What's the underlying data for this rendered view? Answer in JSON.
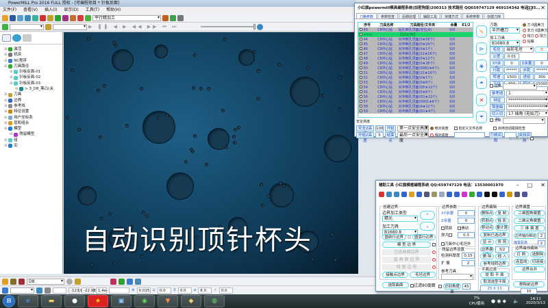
{
  "app": {
    "title": "PowerMILL Pro 2016 FULL 授权 - [可编程项目 * 针板反面]"
  },
  "menu": [
    "文件(F)",
    "查看(V)",
    "插入(I)",
    "显示(D)",
    "工具(T)",
    "帮助(H)"
  ],
  "toolbar": {
    "strategy_combo": "平行精加工"
  },
  "tree": [
    {
      "label": "激活",
      "indent": 0
    },
    {
      "label": "机床",
      "indent": 0
    },
    {
      "label": "NC程序",
      "indent": 0
    },
    {
      "label": "刀具路径",
      "indent": 0
    },
    {
      "label": "针板反面-01",
      "indent": 1
    },
    {
      "label": "针板反面-02",
      "indent": 1
    },
    {
      "label": "针板反面-03",
      "indent": 1
    },
    {
      "label": "> 3_D8_筹凸(关",
      "indent": 2
    },
    {
      "label": "刀具",
      "indent": 0
    },
    {
      "label": "边界",
      "indent": 0
    },
    {
      "label": "参考线",
      "indent": 0
    },
    {
      "label": "特征设置",
      "indent": 0
    },
    {
      "label": "用户坐标系",
      "indent": 0
    },
    {
      "label": "层和组合",
      "indent": 0
    },
    {
      "label": "模型",
      "indent": 0
    },
    {
      "label": "残留模型",
      "indent": 1
    },
    {
      "label": "组",
      "indent": 0
    },
    {
      "label": "宏",
      "indent": 0
    }
  ],
  "overlay_caption": "自动识别顶针杯头",
  "bottom": {
    "tool_combo": "D8",
    "coords": [
      "-123.6",
      "-22.988",
      "1.4e-5"
    ],
    "tolerance": "0.015",
    "thickness": "0.0",
    "axial": "0.0",
    "diameter": "8.0",
    "angle": "0.0"
  },
  "taskbar": {
    "cpu": "7%",
    "cpu_label": "CPU使用",
    "time": "14:11",
    "date": "2020/3/13"
  },
  "dlg1": {
    "title": "小红旗powermill模具编程系统(加密狗版)200313  技术路径 QQ659747129 469154342  电话135...",
    "tabs": [
      "刀路参数",
      "参数检查",
      "后期处理",
      "辅助工具",
      "快捷方式",
      "系统参数",
      "创建刀库"
    ],
    "columns": [
      "序号",
      "刀具名称",
      "刀具路径/文件夹",
      "余量",
      "E1/2"
    ],
    "rows": [
      {
        "no": "43",
        "tool": "C8中心钻",
        "path": "钻孔倒孔顶面(定位点)",
        "allow": "0/0"
      },
      {
        "no": "+++",
        "tool": "",
        "path": "【121/35】",
        "allow": "",
        "hl": true
      },
      {
        "no": "44",
        "tool": "C8中心钻",
        "path": "对冲倒孔顶面(0★56个)",
        "allow": "0/0"
      },
      {
        "no": "45",
        "tool": "C8中心钻",
        "path": "对冲倒孔顶面(0★24个)",
        "allow": "0/0"
      },
      {
        "no": "46",
        "tool": "C8中心钻",
        "path": "对冲倒孔顶面(0★1个)",
        "allow": "0/0"
      },
      {
        "no": "47",
        "tool": "C8中心钻",
        "path": "对冲倒孔顶面(22★16个)",
        "allow": "0/0"
      },
      {
        "no": "48",
        "tool": "C8中心钻",
        "path": "对冲倒孔顶面(0★12个)",
        "allow": "0/0"
      },
      {
        "no": "49",
        "tool": "C8中心钻",
        "path": "对冲倒孔顶面(0★26个)",
        "allow": "0/0"
      },
      {
        "no": "50",
        "tool": "C8中心钻",
        "path": "对冲倒孔顶面(0082★4个)",
        "allow": "0/0"
      },
      {
        "no": "51",
        "tool": "C8中心钻",
        "path": "对冲倒孔顶面(22★16个)",
        "allow": "0/0"
      },
      {
        "no": "52",
        "tool": "C8中心钻",
        "path": "对冲倒孔顶面(0★1个)",
        "allow": "0/0"
      },
      {
        "no": "53",
        "tool": "C8中心钻",
        "path": "对冲倒孔顶面(0★6个)",
        "allow": "0/0"
      },
      {
        "no": "54",
        "tool": "C8中心钻",
        "path": "对冲倒孔顶面(DP★12个)",
        "allow": "0/0"
      },
      {
        "no": "55",
        "tool": "C8中心钻",
        "path": "对冲倒孔顶面(0★6个)",
        "allow": "0/0"
      },
      {
        "no": "56",
        "tool": "C8中心钻",
        "path": "对冲倒孔顶面(D1★22个)",
        "allow": "0/0"
      },
      {
        "no": "57",
        "tool": "C8中心钻",
        "path": "对冲倒孔顶面(0001★6个)",
        "allow": "0/0"
      },
      {
        "no": "58",
        "tool": "C8中心钻",
        "path": "对冲倒孔顶面(A★11个)",
        "allow": "0/0"
      },
      {
        "no": "59",
        "tool": "C8中心钻",
        "path": "对冲倒孔顶面(D1★4个)",
        "allow": "0/0"
      }
    ],
    "toolpath_label": "刀路",
    "toolpath_value": "半开槽刀",
    "tool_label": "加工刀具",
    "tool_value": "B1680.8",
    "radios": [
      "刀 0圆鼻刀",
      "非刀 0圆鼻刀",
      "铣刀",
      "球刀",
      "钻嘴"
    ],
    "params": [
      [
        "毛坯",
        "当前毛坯"
      ],
      [
        "公差",
        "0.01"
      ],
      [
        "XY余量",
        "0",
        "Z余量",
        "0"
      ],
      [
        "行距",
        "******",
        "步距",
        "******"
      ],
      [
        "转速",
        "1500",
        "进给",
        "300"
      ],
      [
        "下切",
        "300",
        "掠过",
        "15000"
      ]
    ],
    "boundary_label": "边界",
    "ref_label": "参考线",
    "ref_value": "1",
    "feature_label": "特征",
    "feature_value": "**********************",
    "feature2_label": "驾驶曲面",
    "feature2_value": "**********************",
    "lead_label": "切入切出",
    "lead_value": "17 插角 (无抬刀)",
    "global_label": "全体",
    "safe_group": "安全高度",
    "safe_z_label": "安全Z高度",
    "safe_z": "100",
    "start_z_label": "开始Z高度",
    "start_z": "5",
    "start_pt_label": "开始点",
    "start_pt": "第一点安全高度",
    "end_pt_label": "结束点",
    "end_pt": "最后一点安全高度",
    "abs_label": "绝对高度",
    "rel_label": "相对高度",
    "custom_name_label": "自定义文件名称",
    "auto_check_label": "启用自动碰撞检查",
    "holder_clear_label": "刀柄间隙",
    "holder_clear2_label": "夹持间隙",
    "max_stock_label": "加工最大毛坯"
  },
  "dlg2": {
    "title": "辅助工具  小红旗模框编程系统  QQ:659747129  电话：13530001970",
    "create_group": "创建边界",
    "btype_label": "边界加工类型",
    "btype_value": "精光",
    "tool_label": "加工刀具",
    "tool_value": "B1680.8",
    "btns_left": [
      "圆剖行边界",
      "圆弧行边界",
      "模 型 边 界",
      "已选曲面边界",
      "直 角 面 边 界",
      "残 留 边 界",
      "接触点边界",
      "毛坯边界",
      "选取曲面",
      "过滤80度面"
    ],
    "param_group": "边界参数",
    "xy_label": "XY余量",
    "xy": "0",
    "z_label": "Z余量",
    "z": "0",
    "top_label": "顶部",
    "slide_label": "滑动",
    "enlarge_label": "放大",
    "enlarge": "0.3",
    "tool_center_label": "刀具中心毛坯外",
    "residual_group": "残留边界设置",
    "detect_label": "检测料厚度",
    "detect": "0.15",
    "expand_label": "扩 展",
    "expand": "2",
    "ref_tool_label": "参考刀具",
    "recog_label": "识别角度面",
    "recog": "45",
    "edit_group": "边界编辑",
    "edit_btns": [
      "删除点",
      "复 制",
      "转割点",
      "投 影",
      "移动点",
      "量计算",
      "复制已选边界",
      "显 示",
      "修 剪",
      "边界偏移",
      "删 除",
      "插 入",
      "参考线转边界"
    ],
    "offset_val": "3/2",
    "plane_group": "平面过滤",
    "extract_plane": "提 取 平 面",
    "pick_plane": "取消选型平面",
    "plane_size": "25 X 13",
    "offset_group": "边界偏置",
    "offset_btns": [
      "二维圆角偏置",
      "二维尖角偏置",
      "三 维 偏 置"
    ],
    "axis_move_label": "边界轴向移动",
    "axis_move": "2",
    "offset_dist_label": "偏置距离",
    "offset_dist": "2",
    "curve_group": "边界曲线编辑",
    "curve_btns": [
      "打 断",
      "选删除",
      "连直线",
      "切连接",
      "边界合并",
      "删除前边界"
    ],
    "last_val": "10"
  }
}
